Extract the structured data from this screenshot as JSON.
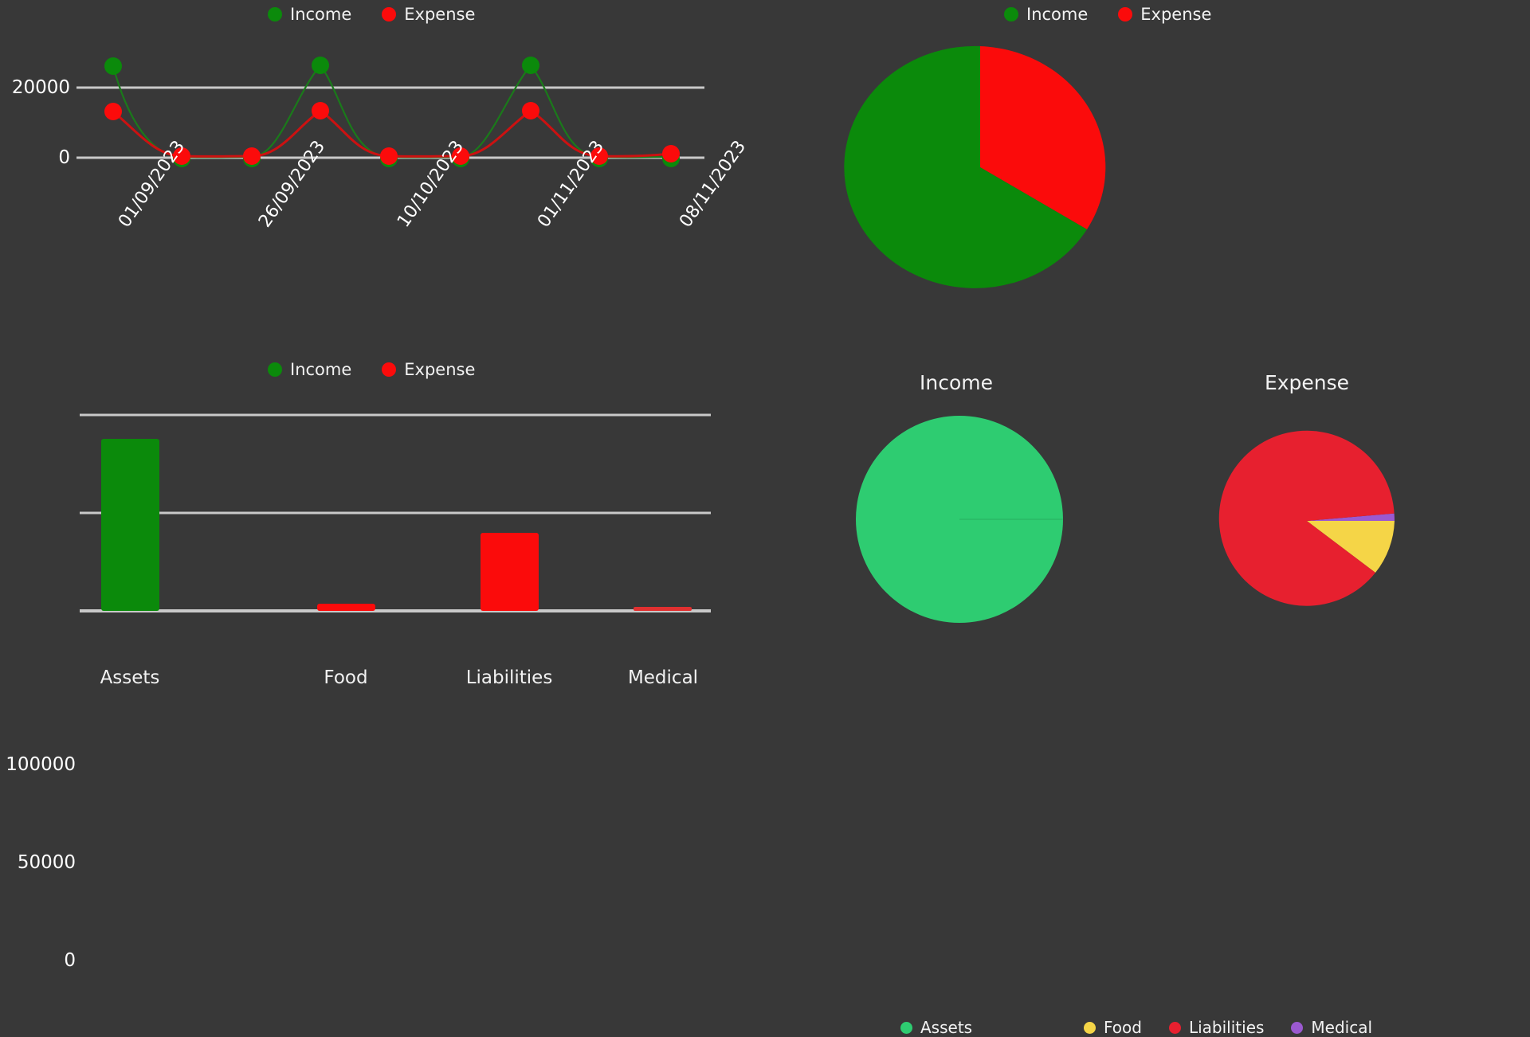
{
  "theme": {
    "background": "#383838",
    "text": "#f2f2f2",
    "gridline": "#c9c9c9",
    "income_green": "#0b8a0b",
    "expense_red": "#fb0b0b",
    "line_green": "#1a7a1a",
    "line_red": "#cc1111",
    "assets_green": "#2ecc71",
    "food_yellow": "#f5d547",
    "liabilities_red": "#e7202f",
    "medical_purple": "#9b59d0"
  },
  "legends": {
    "income": "Income",
    "expense": "Expense",
    "assets": "Assets",
    "food": "Food",
    "liabilities": "Liabilities",
    "medical": "Medical"
  },
  "titles": {
    "income_pie": "Income",
    "expense_pie": "Expense"
  },
  "chart_data": [
    {
      "id": "income-expense-timeline",
      "type": "line",
      "title": "",
      "xlabel": "",
      "ylabel": "",
      "categories": [
        "01/09/2023",
        "26/09/2023",
        "10/10/2023",
        "01/11/2023",
        "08/11/2023"
      ],
      "x_tick_labels": [
        "01/09/2023",
        "26/09/2023",
        "10/10/2023",
        "01/11/2023",
        "08/11/2023"
      ],
      "x_points": [
        "01/09/2023",
        "",
        "",
        "26/09/2023",
        "",
        "",
        "10/10/2023",
        "",
        "",
        "01/11/2023",
        "",
        "",
        "08/11/2023"
      ],
      "y_ticks": [
        0,
        20000
      ],
      "ylim": [
        -1500,
        30000
      ],
      "grid": true,
      "legend_position": "top",
      "series": [
        {
          "name": "Income",
          "color": "#0b8a0b",
          "values": [
            28000,
            200,
            200,
            28000,
            200,
            200,
            200,
            200,
            28000,
            200,
            200
          ]
        },
        {
          "name": "Expense",
          "color": "#fb0b0b",
          "values": [
            14500,
            300,
            300,
            15500,
            300,
            300,
            300,
            300,
            15500,
            300,
            300
          ]
        }
      ],
      "points": {
        "income": [
          {
            "x": 0,
            "y": 28000
          },
          {
            "x": 1,
            "y": 200
          },
          {
            "x": 2,
            "y": 200
          },
          {
            "x": 3,
            "y": 28000
          },
          {
            "x": 4,
            "y": 200
          },
          {
            "x": 5,
            "y": 200
          },
          {
            "x": 6,
            "y": 28000
          },
          {
            "x": 7,
            "y": 200
          },
          {
            "x": 8,
            "y": 200
          }
        ],
        "expense": [
          {
            "x": 0,
            "y": 14500
          },
          {
            "x": 1,
            "y": 300
          },
          {
            "x": 2,
            "y": 300
          },
          {
            "x": 3,
            "y": 15500
          },
          {
            "x": 4,
            "y": 300
          },
          {
            "x": 5,
            "y": 300
          },
          {
            "x": 6,
            "y": 15500
          },
          {
            "x": 7,
            "y": 300
          },
          {
            "x": 8,
            "y": 300
          }
        ]
      }
    },
    {
      "id": "category-totals-bar",
      "type": "bar",
      "title": "",
      "xlabel": "",
      "ylabel": "",
      "categories": [
        "Assets",
        "Food",
        "Liabilities",
        "Medical"
      ],
      "y_ticks": [
        0,
        50000,
        100000
      ],
      "ylim": [
        0,
        110000
      ],
      "grid": true,
      "legend_position": "top",
      "values": [
        88000,
        1800,
        40000,
        800
      ],
      "bar_colors": [
        "#0b8a0b",
        "#fb0b0b",
        "#fb0b0b",
        "#fb0b0b"
      ],
      "series": [
        {
          "name": "Income",
          "color": "#0b8a0b",
          "values": [
            88000,
            0,
            0,
            0
          ]
        },
        {
          "name": "Expense",
          "color": "#fb0b0b",
          "values": [
            0,
            1800,
            40000,
            800
          ]
        }
      ]
    },
    {
      "id": "income-vs-expense-pie",
      "type": "pie",
      "title": "",
      "legend_position": "top",
      "labels": [
        "Income",
        "Expense"
      ],
      "values": [
        65,
        35
      ],
      "colors": [
        "#0b8a0b",
        "#fb0b0b"
      ],
      "start_angle_deg": 0
    },
    {
      "id": "income-breakdown-pie",
      "type": "pie",
      "title": "Income",
      "legend_position": "bottom",
      "labels": [
        "Assets"
      ],
      "values": [
        100
      ],
      "colors": [
        "#2ecc71"
      ],
      "start_angle_deg": 90
    },
    {
      "id": "expense-breakdown-pie",
      "type": "pie",
      "title": "Expense",
      "legend_position": "bottom",
      "labels": [
        "Food",
        "Liabilities",
        "Medical"
      ],
      "values": [
        5,
        93.5,
        1.5
      ],
      "colors": [
        "#f5d547",
        "#e7202f",
        "#9b59d0"
      ],
      "start_angle_deg": 90
    }
  ]
}
